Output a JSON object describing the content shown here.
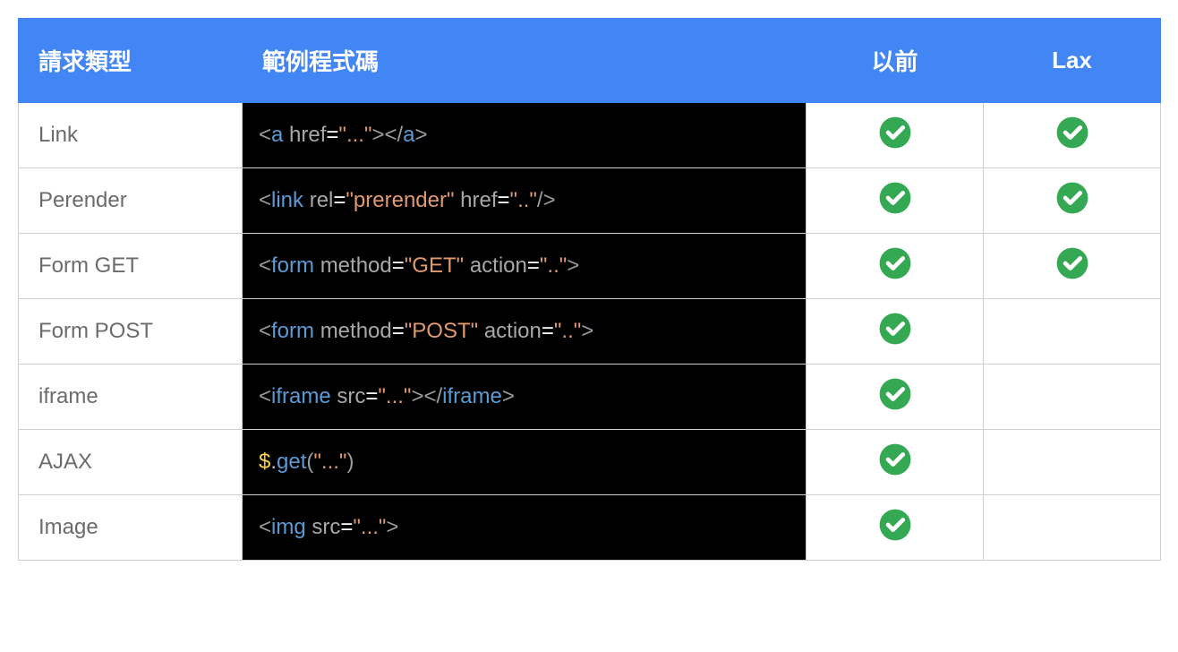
{
  "headers": {
    "request_type": "請求類型",
    "example_code": "範例程式碼",
    "before": "以前",
    "lax": "Lax"
  },
  "rows": [
    {
      "type": "Link",
      "code": [
        {
          "t": "punc",
          "v": "<"
        },
        {
          "t": "tag",
          "v": "a"
        },
        {
          "t": "plain",
          "v": " "
        },
        {
          "t": "attr",
          "v": "href"
        },
        {
          "t": "eq",
          "v": "="
        },
        {
          "t": "string",
          "v": "\"...\""
        },
        {
          "t": "punc",
          "v": "></"
        },
        {
          "t": "tag",
          "v": "a"
        },
        {
          "t": "punc",
          "v": ">"
        }
      ],
      "before": true,
      "lax": true
    },
    {
      "type": "Perender",
      "code": [
        {
          "t": "punc",
          "v": "<"
        },
        {
          "t": "tag",
          "v": "link"
        },
        {
          "t": "plain",
          "v": " "
        },
        {
          "t": "attr",
          "v": "rel"
        },
        {
          "t": "eq",
          "v": "="
        },
        {
          "t": "string",
          "v": "\"prerender\""
        },
        {
          "t": "plain",
          "v": " "
        },
        {
          "t": "attr",
          "v": "href"
        },
        {
          "t": "eq",
          "v": "="
        },
        {
          "t": "string",
          "v": "\"..\""
        },
        {
          "t": "punc",
          "v": "/>"
        }
      ],
      "before": true,
      "lax": true
    },
    {
      "type": "Form GET",
      "code": [
        {
          "t": "punc",
          "v": "<"
        },
        {
          "t": "tag",
          "v": "form"
        },
        {
          "t": "plain",
          "v": " "
        },
        {
          "t": "attr",
          "v": "method"
        },
        {
          "t": "eq",
          "v": "="
        },
        {
          "t": "string",
          "v": "\"GET\""
        },
        {
          "t": "plain",
          "v": " "
        },
        {
          "t": "attr",
          "v": "action"
        },
        {
          "t": "eq",
          "v": "="
        },
        {
          "t": "string",
          "v": "\"..\""
        },
        {
          "t": "punc",
          "v": ">"
        }
      ],
      "before": true,
      "lax": true
    },
    {
      "type": "Form POST",
      "code": [
        {
          "t": "punc",
          "v": "<"
        },
        {
          "t": "tag",
          "v": "form"
        },
        {
          "t": "plain",
          "v": " "
        },
        {
          "t": "attr",
          "v": "method"
        },
        {
          "t": "eq",
          "v": "="
        },
        {
          "t": "string",
          "v": "\"POST\""
        },
        {
          "t": "plain",
          "v": " "
        },
        {
          "t": "attr",
          "v": "action"
        },
        {
          "t": "eq",
          "v": "="
        },
        {
          "t": "string",
          "v": "\"..\""
        },
        {
          "t": "punc",
          "v": ">"
        }
      ],
      "before": true,
      "lax": false
    },
    {
      "type": "iframe",
      "code": [
        {
          "t": "punc",
          "v": "<"
        },
        {
          "t": "tag",
          "v": "iframe"
        },
        {
          "t": "plain",
          "v": " "
        },
        {
          "t": "attr",
          "v": "src"
        },
        {
          "t": "eq",
          "v": "="
        },
        {
          "t": "string",
          "v": "\"...\""
        },
        {
          "t": "punc",
          "v": "></"
        },
        {
          "t": "tag",
          "v": "iframe"
        },
        {
          "t": "punc",
          "v": ">"
        }
      ],
      "before": true,
      "lax": false
    },
    {
      "type": "AJAX",
      "code": [
        {
          "t": "dollar",
          "v": "$"
        },
        {
          "t": "dot",
          "v": "."
        },
        {
          "t": "tag",
          "v": "get"
        },
        {
          "t": "punc",
          "v": "("
        },
        {
          "t": "string",
          "v": "\"...\""
        },
        {
          "t": "punc",
          "v": ")"
        }
      ],
      "before": true,
      "lax": false
    },
    {
      "type": "Image",
      "code": [
        {
          "t": "punc",
          "v": "<"
        },
        {
          "t": "tag",
          "v": "img"
        },
        {
          "t": "plain",
          "v": " "
        },
        {
          "t": "attr",
          "v": "src"
        },
        {
          "t": "eq",
          "v": "="
        },
        {
          "t": "string",
          "v": "\"...\""
        },
        {
          "t": "punc",
          "v": ">"
        }
      ],
      "before": true,
      "lax": false
    }
  ],
  "colors": {
    "header_bg": "#4285f4",
    "check_green": "#34a853"
  }
}
